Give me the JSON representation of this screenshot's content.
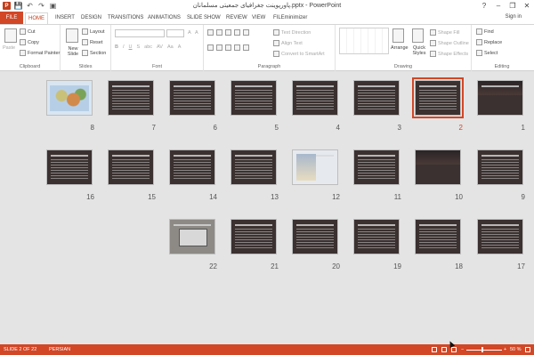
{
  "window": {
    "title": "پاورپوینت جغرافیای جمعیتی مسلمانان.pptx - PowerPoint",
    "min": "–",
    "max": "❐",
    "close": "✕",
    "help": "?"
  },
  "qat": {
    "app_icon": "P",
    "save": "💾",
    "undo": "↶",
    "redo": "↷",
    "start": "▣"
  },
  "tabs": {
    "file": "FILE",
    "home": "HOME",
    "insert": "INSERT",
    "design": "DESIGN",
    "transitions": "TRANSITIONS",
    "animations": "ANIMATIONS",
    "slideshow": "SLIDE SHOW",
    "review": "REVIEW",
    "view": "VIEW",
    "fileminimizer": "FILEminimizer"
  },
  "account": {
    "signin": "Sign in"
  },
  "ribbon": {
    "clipboard": {
      "label": "Clipboard",
      "paste": "Paste",
      "cut": "Cut",
      "copy": "Copy",
      "format_painter": "Format Painter"
    },
    "slides": {
      "label": "Slides",
      "new_slide": "New Slide",
      "layout": "Layout",
      "reset": "Reset",
      "section": "Section"
    },
    "font": {
      "label": "Font"
    },
    "paragraph": {
      "label": "Paragraph",
      "text_direction": "Text Direction",
      "align_text": "Align Text",
      "convert": "Convert to SmartArt"
    },
    "drawing": {
      "label": "Drawing",
      "arrange": "Arrange",
      "quick_styles": "Quick Styles",
      "shape_fill": "Shape Fill",
      "shape_outline": "Shape Outline",
      "shape_effects": "Shape Effects"
    },
    "editing": {
      "label": "Editing",
      "find": "Find",
      "replace": "Replace",
      "select": "Select"
    }
  },
  "slides": [
    {
      "n": "1",
      "kind": "title"
    },
    {
      "n": "2",
      "kind": "text",
      "selected": true
    },
    {
      "n": "3",
      "kind": "text"
    },
    {
      "n": "4",
      "kind": "text"
    },
    {
      "n": "5",
      "kind": "text"
    },
    {
      "n": "6",
      "kind": "text"
    },
    {
      "n": "7",
      "kind": "text"
    },
    {
      "n": "8",
      "kind": "map"
    },
    {
      "n": "9",
      "kind": "text"
    },
    {
      "n": "10",
      "kind": "blank"
    },
    {
      "n": "11",
      "kind": "text"
    },
    {
      "n": "12",
      "kind": "image"
    },
    {
      "n": "13",
      "kind": "text"
    },
    {
      "n": "14",
      "kind": "text"
    },
    {
      "n": "15",
      "kind": "text"
    },
    {
      "n": "16",
      "kind": "text"
    },
    {
      "n": "17",
      "kind": "text"
    },
    {
      "n": "18",
      "kind": "text"
    },
    {
      "n": "19",
      "kind": "text"
    },
    {
      "n": "20",
      "kind": "text"
    },
    {
      "n": "21",
      "kind": "text"
    },
    {
      "n": "22",
      "kind": "photo"
    }
  ],
  "status": {
    "slide": "SLIDE 2 OF 22",
    "language": "PERSIAN",
    "zoom": "50 %"
  },
  "colors": {
    "accent": "#d24726",
    "status_bg": "#d24726",
    "slide_bg": "#3a3130"
  }
}
